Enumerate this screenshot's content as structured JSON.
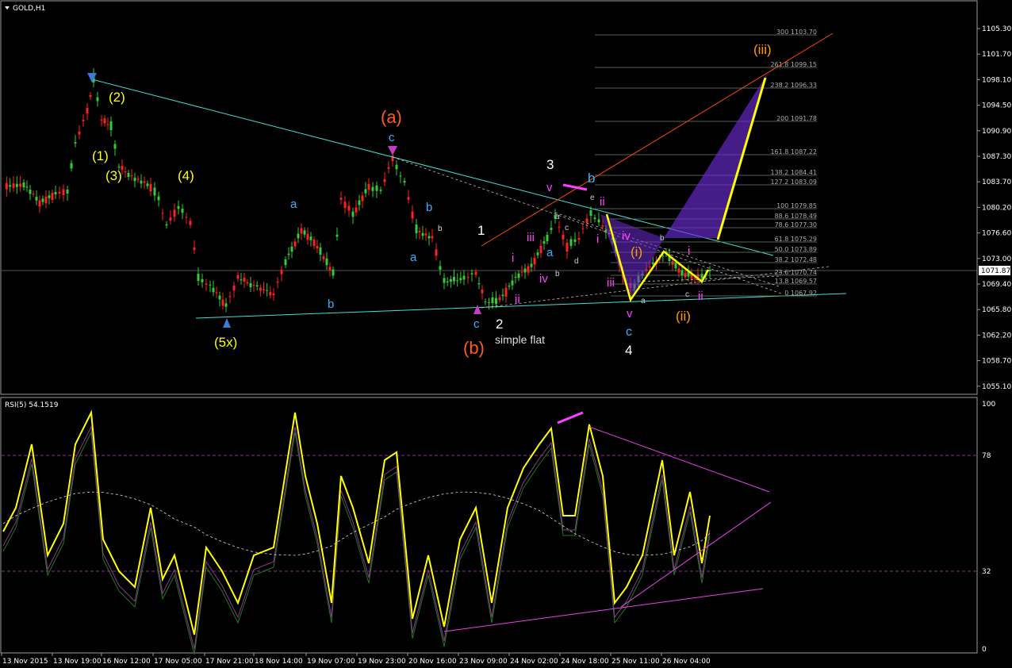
{
  "window": {
    "title": "GOLD,H1",
    "menu_icon": "triangle-down-icon"
  },
  "main_chart": {
    "price_axis": [
      "1105.30",
      "1101.70",
      "1098.10",
      "1094.50",
      "1090.90",
      "1087.30",
      "1083.70",
      "1080.20",
      "1076.60",
      "1073.00",
      "1069.40",
      "1065.80",
      "1062.20",
      "1058.70",
      "1055.10"
    ],
    "current_price": "1071.87",
    "fib_levels": [
      {
        "label": "300 1103.70"
      },
      {
        "label": "261.8 1099.15"
      },
      {
        "label": "238.2 1096.33"
      },
      {
        "label": "200 1091.78"
      },
      {
        "label": "161.8 1087.22"
      },
      {
        "label": "138.2 1084.41"
      },
      {
        "label": "127.2 1083.09"
      },
      {
        "label": "100 1079.85"
      },
      {
        "label": "88.6 1078.49"
      },
      {
        "label": "78.6 1077.30"
      },
      {
        "label": "61.8 1075.29"
      },
      {
        "label": "50.0 1073.89"
      },
      {
        "label": "38.2 1072.48"
      },
      {
        "label": "23.6 1070.74"
      },
      {
        "label": "13.8 1069.57"
      },
      {
        "label": "0 1067.92"
      }
    ],
    "wave_labels": {
      "w2": "(2)",
      "w1": "(1)",
      "w3": "(3)",
      "w4": "(4)",
      "w5x": "(5x)",
      "a_top": "(a)",
      "b_low": "(b)",
      "c_top": "c",
      "c_low": "c",
      "a1": "a",
      "b1": "b",
      "a2": "a",
      "b2": "b",
      "b3": "b",
      "one": "1",
      "two": "2",
      "three": "3",
      "four": "4",
      "simple_flat": "simple flat",
      "i1": "i",
      "ii1": "ii",
      "iii1": "iii",
      "iv1": "iv",
      "v1": "v",
      "a3": "a",
      "b4": "b",
      "b5": "b",
      "ii2": "ii",
      "i2": "i",
      "iii2": "iii",
      "iv2": "iv",
      "v2": "v",
      "c_low2": "c",
      "wi": "(i)",
      "wii": "(ii)",
      "wiii": "(iii)",
      "i3": "i",
      "ii3": "ii",
      "sa": "a",
      "sb": "b",
      "sc": "c",
      "sd": "d",
      "se": "e",
      "tb": "b",
      "tc": "c",
      "ta": "a"
    }
  },
  "rsi": {
    "title": "RSI(5) 54.1519",
    "levels": [
      "100",
      "78",
      "32",
      "0"
    ]
  },
  "time_axis": [
    "13 Nov 2015",
    "13 Nov 19:00",
    "16 Nov 12:00",
    "17 Nov 05:00",
    "17 Nov 21:00",
    "18 Nov 14:00",
    "19 Nov 07:00",
    "19 Nov 23:00",
    "20 Nov 16:00",
    "23 Nov 09:00",
    "24 Nov 02:00",
    "24 Nov 18:00",
    "25 Nov 11:00",
    "26 Nov 04:00"
  ],
  "colors": {
    "bull": "#32cd32",
    "bear": "#ff2020",
    "trend": "#40e0d0",
    "rsi": "#ffff00",
    "accent": "#ee40ee"
  }
}
